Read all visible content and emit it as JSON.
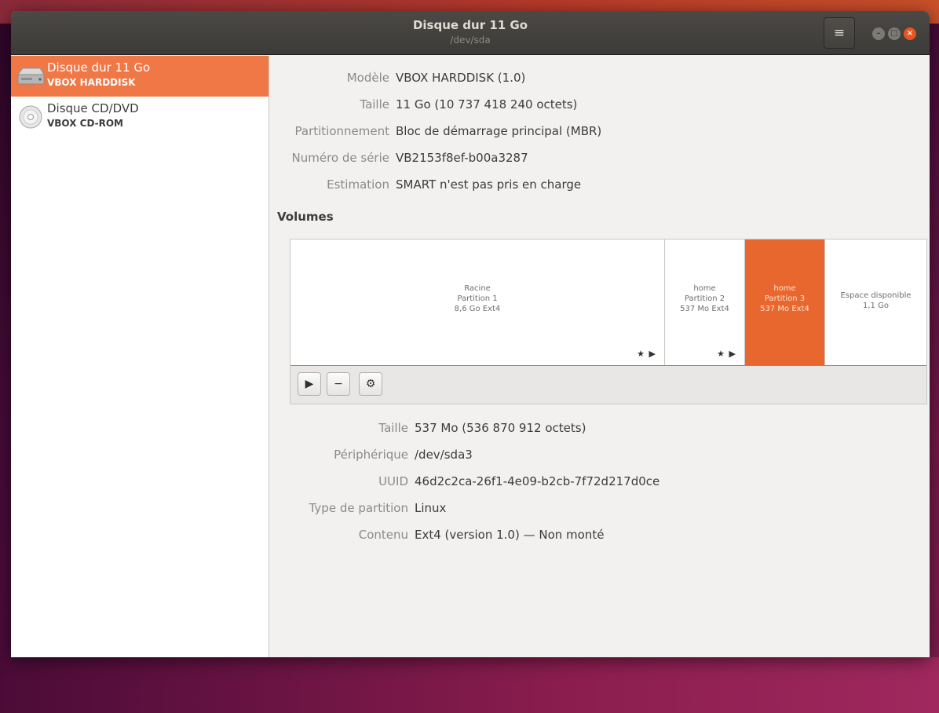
{
  "window": {
    "title": "Disque dur 11 Go",
    "subtitle": "/dev/sda",
    "menu_icon": "hamburger-menu-icon",
    "controls": {
      "minimize": "–",
      "maximize": "□",
      "close": "×"
    },
    "accent": "#e95420"
  },
  "sidebar": {
    "drives": [
      {
        "name": "Disque dur 11 Go",
        "sub": "VBOX HARDDISK",
        "icon": "hard-disk-icon",
        "selected": true
      },
      {
        "name": "Disque CD/DVD",
        "sub": "VBOX CD-ROM",
        "icon": "optical-disc-icon",
        "selected": false
      }
    ]
  },
  "disk": {
    "model_label": "Modèle",
    "model": "VBOX HARDDISK (1.0)",
    "size_label": "Taille",
    "size": "11 Go (10 737 418 240 octets)",
    "partitioning_label": "Partitionnement",
    "partitioning": "Bloc de démarrage principal (MBR)",
    "serial_label": "Numéro de série",
    "serial": "VB2153f8ef-b00a3287",
    "assessment_label": "Estimation",
    "assessment": "SMART n'est pas pris en charge"
  },
  "volumes": {
    "title": "Volumes",
    "segments": [
      {
        "line1": "Racine",
        "line2": "Partition 1",
        "line3": "8,6 Go Ext4",
        "marks": "★ ▶",
        "selected": false
      },
      {
        "line1": "home",
        "line2": "Partition 2",
        "line3": "537 Mo Ext4",
        "marks": "★ ▶",
        "selected": false
      },
      {
        "line1": "home",
        "line2": "Partition 3",
        "line3": "537 Mo Ext4",
        "marks": "",
        "selected": true
      },
      {
        "line1": "Espace disponible",
        "line2": "1,1 Go",
        "line3": "",
        "marks": "",
        "selected": false
      }
    ],
    "toolbar": {
      "mount": "▶",
      "delete": "−",
      "settings": "⚙"
    }
  },
  "partition": {
    "size_label": "Taille",
    "size": "537 Mo (536 870 912 octets)",
    "device_label": "Périphérique",
    "device": "/dev/sda3",
    "uuid_label": "UUID",
    "uuid": "46d2c2ca-26f1-4e09-b2cb-7f72d217d0ce",
    "type_label": "Type de partition",
    "type": "Linux",
    "contents_label": "Contenu",
    "contents": "Ext4 (version 1.0) — Non monté"
  }
}
